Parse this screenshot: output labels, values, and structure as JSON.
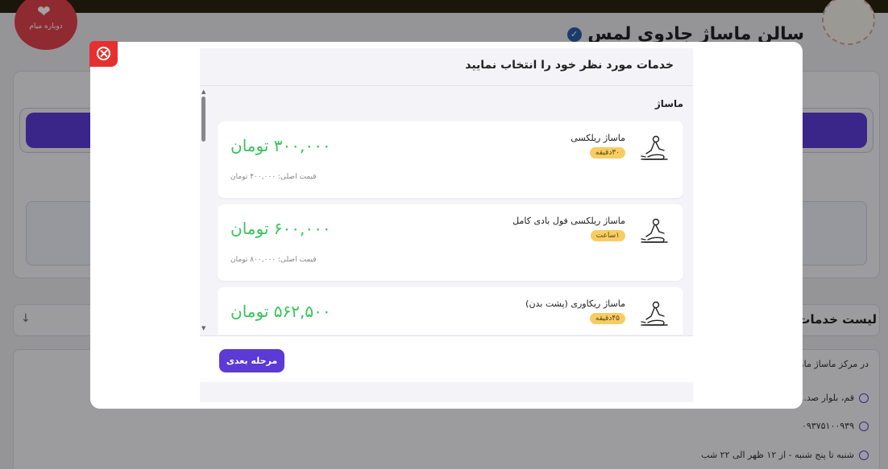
{
  "background": {
    "badge_text": "دوباره میام",
    "salon_title": "سالن ماساژ جادوی لمس",
    "list_title": "لیست خدمات",
    "about_text": "در مرکز ماساژ ما، با ...",
    "address": "قم، بلوار صد...",
    "phone": "۰۹۳۷۵۱۰۰۹۳۹",
    "hours": "شنبه تا پنج شنبه - از ۱۲ ظهر الی ۲۲ شب"
  },
  "modal": {
    "title": "خدمات مورد نظر خود را انتخاب نمایید",
    "category": "ماساژ",
    "services": [
      {
        "name": "ماساژ ریلکسی",
        "duration": "۳۰دقیقه",
        "price": "۳۰۰,۰۰۰ تومان",
        "original_price": "قیمت اصلی: ۴۰۰,۰۰۰ تومان"
      },
      {
        "name": "ماساژ ریلکسی فول بادی کامل",
        "duration": "۱ساعت",
        "price": "۶۰۰,۰۰۰ تومان",
        "original_price": "قیمت اصلی: ۸۰۰,۰۰۰ تومان"
      },
      {
        "name": "ماساژ ریکاوری (پشت بدن)",
        "duration": "۴۵دقیقه",
        "price": "۵۶۲,۵۰۰ تومان",
        "original_price": ""
      }
    ],
    "next_button": "مرحله بعدی"
  },
  "colors": {
    "accent": "#5b3ad6",
    "price": "#37c45a",
    "close": "#e53030",
    "duration_badge": "#f7cd63"
  },
  "icons": [
    "close-icon",
    "massage-icon",
    "verified-icon",
    "location-icon",
    "phone-icon",
    "clock-icon",
    "arrow-down-icon"
  ]
}
